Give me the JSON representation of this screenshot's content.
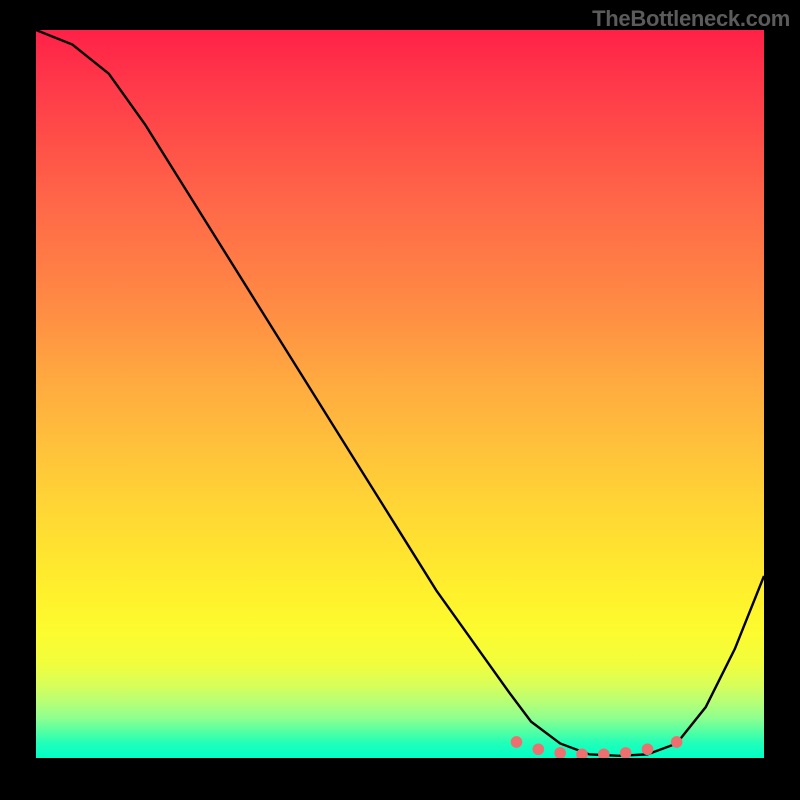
{
  "watermark": "TheBottleneck.com",
  "colors": {
    "curve": "#000000",
    "markers": "#ed6f70",
    "background_black": "#000000"
  },
  "chart_data": {
    "type": "line",
    "title": "",
    "xlabel": "",
    "ylabel": "",
    "xlim": [
      0,
      100
    ],
    "ylim": [
      0,
      100
    ],
    "grid": false,
    "legend": false,
    "series": [
      {
        "name": "bottleneck-curve",
        "x": [
          0,
          5,
          10,
          15,
          20,
          25,
          30,
          35,
          40,
          45,
          50,
          55,
          60,
          65,
          68,
          72,
          76,
          80,
          84,
          88,
          92,
          96,
          100
        ],
        "y": [
          100,
          98,
          94,
          87,
          79,
          71,
          63,
          55,
          47,
          39,
          31,
          23,
          16,
          9,
          5,
          2,
          0.5,
          0.3,
          0.5,
          2,
          7,
          15,
          25
        ]
      }
    ],
    "markers": {
      "name": "marker-cluster",
      "x": [
        66,
        69,
        72,
        75,
        78,
        81,
        84,
        88
      ],
      "y": [
        2.2,
        1.2,
        0.7,
        0.5,
        0.5,
        0.7,
        1.2,
        2.2
      ]
    }
  }
}
